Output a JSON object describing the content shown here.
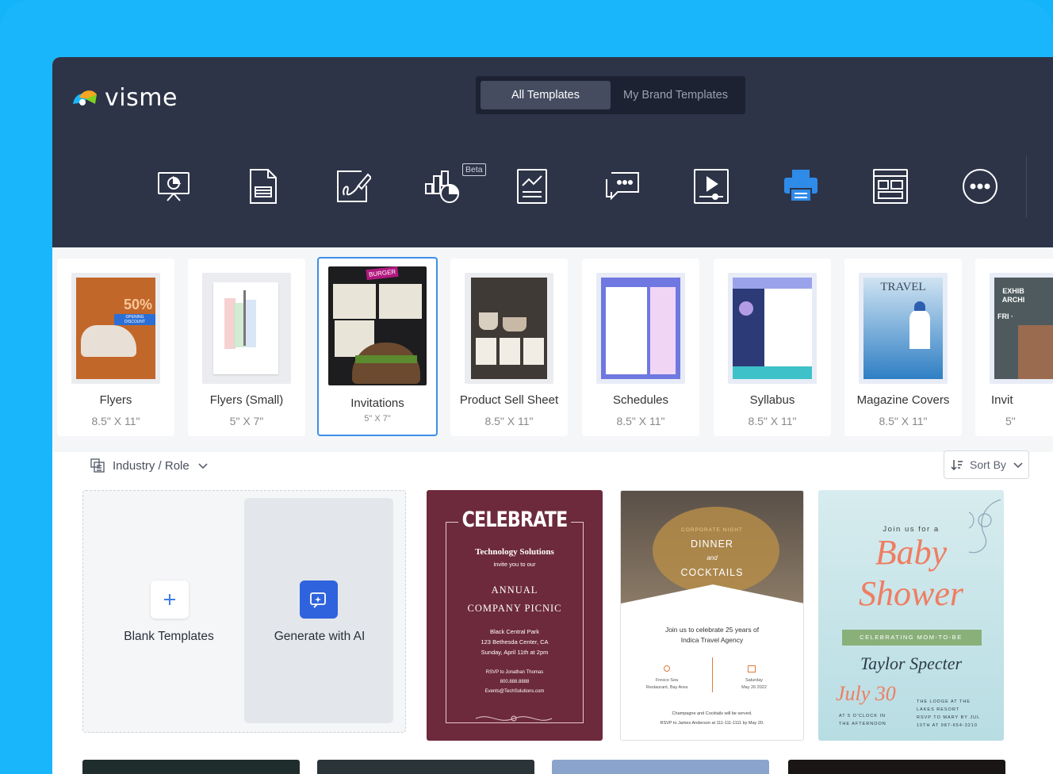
{
  "brand": {
    "logo_text": "visme"
  },
  "template_tabs": [
    {
      "label": "All Templates",
      "active": true
    },
    {
      "label": "My Brand Templates",
      "active": false
    }
  ],
  "type_icons": [
    {
      "name": "presentation-icon"
    },
    {
      "name": "document-icon"
    },
    {
      "name": "whiteboard-icon",
      "badge": "Beta"
    },
    {
      "name": "infographic-chart-icon"
    },
    {
      "name": "report-icon"
    },
    {
      "name": "social-media-icon"
    },
    {
      "name": "video-icon"
    },
    {
      "name": "printables-icon",
      "active": true
    },
    {
      "name": "web-graphics-icon"
    },
    {
      "name": "more-icon"
    }
  ],
  "categories": [
    {
      "name": "Flyers",
      "size": "8.5\" X 11\""
    },
    {
      "name": "Flyers (Small)",
      "size": "5\" X 7\""
    },
    {
      "name": "Invitations",
      "size": "5\" X 7\"",
      "selected": true
    },
    {
      "name": "Product Sell Sheet",
      "size": "8.5\" X 11\""
    },
    {
      "name": "Schedules",
      "size": "8.5\" X 11\""
    },
    {
      "name": "Syllabus",
      "size": "8.5\" X 11\""
    },
    {
      "name": "Magazine Covers",
      "size": "8.5\" X 11\""
    },
    {
      "name": "Invit",
      "size": "5\""
    }
  ],
  "thumb_text": {
    "flyer_discount": "50%",
    "flyer_opening": "OPENING DISCOUNT",
    "menu_badge": "BURGER",
    "magazine_title": "TRAVEL",
    "partial_text": "EXHIB ARCHI",
    "partial_sub": "FRI ·"
  },
  "filter": {
    "label": "Industry / Role"
  },
  "sort": {
    "label": "Sort By"
  },
  "blank": {
    "blank_label": "Blank Templates",
    "ai_label": "Generate with AI"
  },
  "templates": {
    "celebrate": {
      "title": "CELEBRATE",
      "company": "Technology Solutions",
      "invite": "invite you to our",
      "event_line1": "ANNUAL",
      "event_line2": "COMPANY PICNIC",
      "venue": "Black Central Park",
      "address": "123 Bethesda Center, CA",
      "date": "Sunday, April 11th at 2pm",
      "rsvp": "RSVP to Jonathan Thomas",
      "phone": "800.888.8888",
      "email": "Events@TechSolutions.com"
    },
    "dinner": {
      "kicker": "CORPORATE NIGHT",
      "line1": "DINNER",
      "and": "and",
      "line2": "COCKTAILS",
      "join_line1": "Join us to celebrate 25 years of",
      "join_line2": "Indica Travel Agency",
      "place1": "Fresco Sea",
      "place2": "Restaurant, Bay Area",
      "day": "Saturday",
      "date": "May 26 2022",
      "served": "Champagne and Cocktails will be served.",
      "rsvp": "RSVP to James Anderson at 111-111-1111 by May 20."
    },
    "baby": {
      "intro": "Join us for a",
      "title1": "Baby",
      "title2": "Shower",
      "banner": "CELEBRATING MOM-TO-BE",
      "name": "Taylor Specter",
      "date": "July 30",
      "time1": "AT 5 O'CLOCK IN",
      "time2": "THE AFTERNOON",
      "venue1": "THE LODGE AT THE",
      "venue2": "LAKES RESORT",
      "rsvp1": "RSVP TO MARY BY JUL",
      "rsvp2": "10TH AT 987-654-3210"
    }
  },
  "colors": {
    "accent": "#1ab6fb",
    "topbar": "#2d3448",
    "selected_border": "#3d8ee8",
    "celebrate_bg": "#6d2a3c",
    "ai_button": "#2f62dd"
  }
}
